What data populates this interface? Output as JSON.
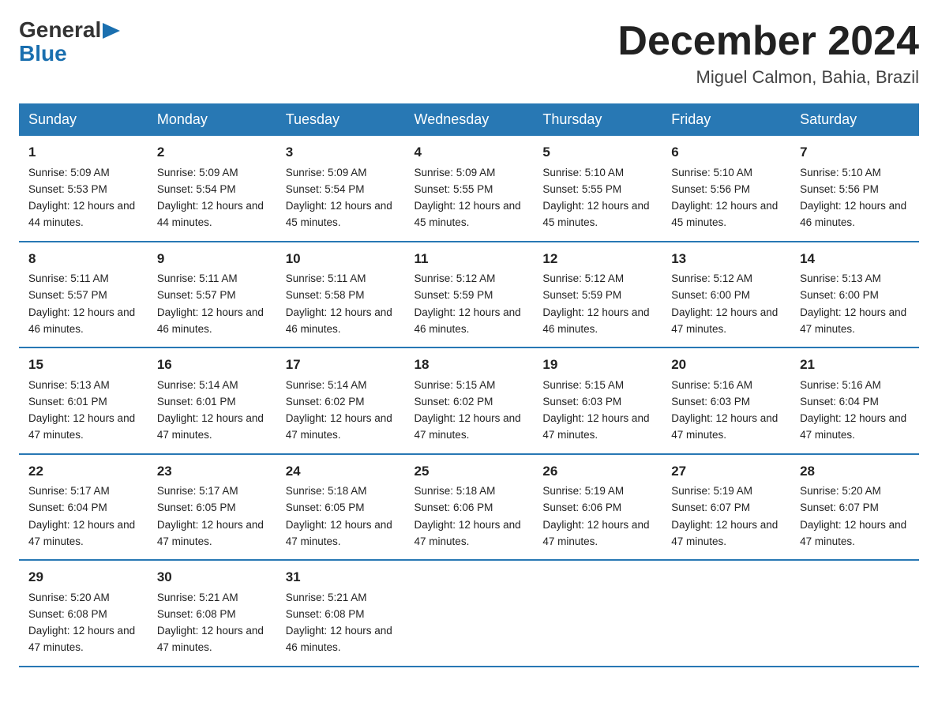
{
  "logo": {
    "general": "General",
    "blue": "Blue"
  },
  "title": "December 2024",
  "location": "Miguel Calmon, Bahia, Brazil",
  "days_of_week": [
    "Sunday",
    "Monday",
    "Tuesday",
    "Wednesday",
    "Thursday",
    "Friday",
    "Saturday"
  ],
  "weeks": [
    [
      {
        "day": "1",
        "sunrise": "5:09 AM",
        "sunset": "5:53 PM",
        "daylight": "12 hours and 44 minutes."
      },
      {
        "day": "2",
        "sunrise": "5:09 AM",
        "sunset": "5:54 PM",
        "daylight": "12 hours and 44 minutes."
      },
      {
        "day": "3",
        "sunrise": "5:09 AM",
        "sunset": "5:54 PM",
        "daylight": "12 hours and 45 minutes."
      },
      {
        "day": "4",
        "sunrise": "5:09 AM",
        "sunset": "5:55 PM",
        "daylight": "12 hours and 45 minutes."
      },
      {
        "day": "5",
        "sunrise": "5:10 AM",
        "sunset": "5:55 PM",
        "daylight": "12 hours and 45 minutes."
      },
      {
        "day": "6",
        "sunrise": "5:10 AM",
        "sunset": "5:56 PM",
        "daylight": "12 hours and 45 minutes."
      },
      {
        "day": "7",
        "sunrise": "5:10 AM",
        "sunset": "5:56 PM",
        "daylight": "12 hours and 46 minutes."
      }
    ],
    [
      {
        "day": "8",
        "sunrise": "5:11 AM",
        "sunset": "5:57 PM",
        "daylight": "12 hours and 46 minutes."
      },
      {
        "day": "9",
        "sunrise": "5:11 AM",
        "sunset": "5:57 PM",
        "daylight": "12 hours and 46 minutes."
      },
      {
        "day": "10",
        "sunrise": "5:11 AM",
        "sunset": "5:58 PM",
        "daylight": "12 hours and 46 minutes."
      },
      {
        "day": "11",
        "sunrise": "5:12 AM",
        "sunset": "5:59 PM",
        "daylight": "12 hours and 46 minutes."
      },
      {
        "day": "12",
        "sunrise": "5:12 AM",
        "sunset": "5:59 PM",
        "daylight": "12 hours and 46 minutes."
      },
      {
        "day": "13",
        "sunrise": "5:12 AM",
        "sunset": "6:00 PM",
        "daylight": "12 hours and 47 minutes."
      },
      {
        "day": "14",
        "sunrise": "5:13 AM",
        "sunset": "6:00 PM",
        "daylight": "12 hours and 47 minutes."
      }
    ],
    [
      {
        "day": "15",
        "sunrise": "5:13 AM",
        "sunset": "6:01 PM",
        "daylight": "12 hours and 47 minutes."
      },
      {
        "day": "16",
        "sunrise": "5:14 AM",
        "sunset": "6:01 PM",
        "daylight": "12 hours and 47 minutes."
      },
      {
        "day": "17",
        "sunrise": "5:14 AM",
        "sunset": "6:02 PM",
        "daylight": "12 hours and 47 minutes."
      },
      {
        "day": "18",
        "sunrise": "5:15 AM",
        "sunset": "6:02 PM",
        "daylight": "12 hours and 47 minutes."
      },
      {
        "day": "19",
        "sunrise": "5:15 AM",
        "sunset": "6:03 PM",
        "daylight": "12 hours and 47 minutes."
      },
      {
        "day": "20",
        "sunrise": "5:16 AM",
        "sunset": "6:03 PM",
        "daylight": "12 hours and 47 minutes."
      },
      {
        "day": "21",
        "sunrise": "5:16 AM",
        "sunset": "6:04 PM",
        "daylight": "12 hours and 47 minutes."
      }
    ],
    [
      {
        "day": "22",
        "sunrise": "5:17 AM",
        "sunset": "6:04 PM",
        "daylight": "12 hours and 47 minutes."
      },
      {
        "day": "23",
        "sunrise": "5:17 AM",
        "sunset": "6:05 PM",
        "daylight": "12 hours and 47 minutes."
      },
      {
        "day": "24",
        "sunrise": "5:18 AM",
        "sunset": "6:05 PM",
        "daylight": "12 hours and 47 minutes."
      },
      {
        "day": "25",
        "sunrise": "5:18 AM",
        "sunset": "6:06 PM",
        "daylight": "12 hours and 47 minutes."
      },
      {
        "day": "26",
        "sunrise": "5:19 AM",
        "sunset": "6:06 PM",
        "daylight": "12 hours and 47 minutes."
      },
      {
        "day": "27",
        "sunrise": "5:19 AM",
        "sunset": "6:07 PM",
        "daylight": "12 hours and 47 minutes."
      },
      {
        "day": "28",
        "sunrise": "5:20 AM",
        "sunset": "6:07 PM",
        "daylight": "12 hours and 47 minutes."
      }
    ],
    [
      {
        "day": "29",
        "sunrise": "5:20 AM",
        "sunset": "6:08 PM",
        "daylight": "12 hours and 47 minutes."
      },
      {
        "day": "30",
        "sunrise": "5:21 AM",
        "sunset": "6:08 PM",
        "daylight": "12 hours and 47 minutes."
      },
      {
        "day": "31",
        "sunrise": "5:21 AM",
        "sunset": "6:08 PM",
        "daylight": "12 hours and 46 minutes."
      },
      null,
      null,
      null,
      null
    ]
  ]
}
